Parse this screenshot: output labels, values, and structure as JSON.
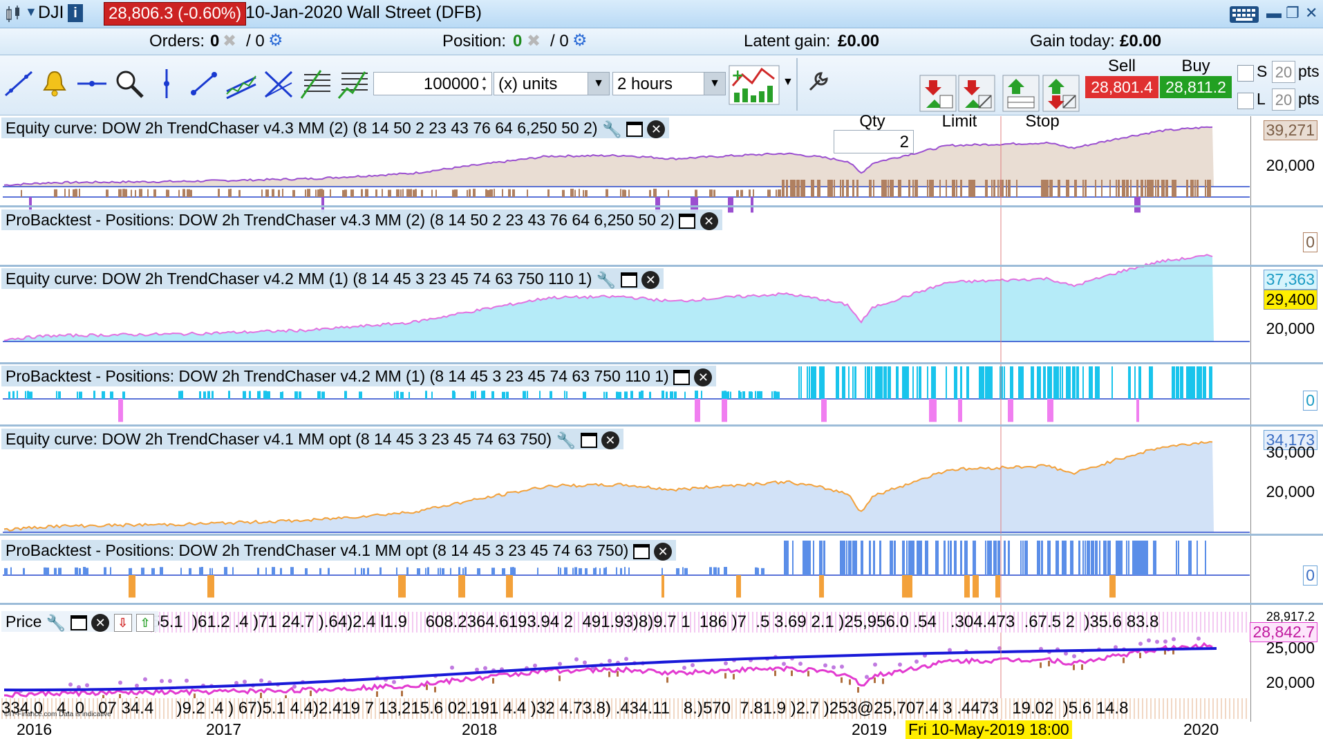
{
  "window": {
    "symbol": "DJI",
    "info_icon": "i",
    "price_change": "28,806.3 (-0.60%)",
    "date": "10-Jan-2020",
    "market": "Wall Street (DFB)"
  },
  "infobar": {
    "orders_label": "Orders:",
    "orders_value": "0",
    "orders_total": "/ 0",
    "position_label": "Position:",
    "position_value": "0",
    "position_total": "/ 0",
    "latent_label": "Latent gain:",
    "latent_value": "£0.00",
    "gain_today_label": "Gain today:",
    "gain_today_value": "£0.00"
  },
  "toolbar": {
    "units_value": "100000",
    "units_label": "(x) units",
    "timeframe": "2 hours",
    "qty_label": "Qty",
    "qty_value": "2",
    "limit_label": "Limit",
    "stop_label": "Stop",
    "sell_label": "Sell",
    "buy_label": "Buy",
    "sell_price": "28,801.4",
    "buy_price": "28,811.2",
    "s_label": "S",
    "l_label": "L",
    "s_pts_value": "20",
    "l_pts_value": "20",
    "pts_label": "pts"
  },
  "panels": {
    "eq3": {
      "title": "Equity curve: DOW 2h TrendChaser v4.3 MM (2) (8 14 50 2 23 43 76 64 6,250 50 2)",
      "last_value": "39,271",
      "axis_label": "20,000",
      "fill": "#e9ddd3",
      "line": "#9b4fd0"
    },
    "pos3": {
      "title": "ProBacktest - Positions: DOW 2h TrendChaser v4.3 MM (2) (8 14 50 2 23 43 76 64 6,250 50 2)",
      "axis_label": "0",
      "long_color": "#b08060",
      "short_color": "#9b4fd0"
    },
    "eq2": {
      "title": "Equity curve: DOW 2h TrendChaser v4.2 MM (1) (8 14 45 3 23 45 74 63 750 110 1)",
      "last_value": "37,363",
      "level_value": "29,400",
      "axis_label": "20,000",
      "fill": "#b5ebf8",
      "line": "#e271e0"
    },
    "pos2": {
      "title": "ProBacktest - Positions: DOW 2h TrendChaser v4.2 MM (1) (8 14 45 3 23 45 74 63 750 110 1)",
      "axis_label": "0",
      "long_color": "#19c4ec",
      "short_color": "#f07ef0"
    },
    "eq1": {
      "title": "Equity curve: DOW 2h TrendChaser v4.1 MM opt (8 14 45 3 23 45 74 63 750)",
      "last_value": "34,173",
      "axis_label_top": "30,000",
      "axis_label": "20,000",
      "fill": "#d2e2f7",
      "line": "#f3a13a"
    },
    "pos1": {
      "title": "ProBacktest - Positions: DOW 2h TrendChaser v4.1 MM opt (8 14 45 3 23 45 74 63 750)",
      "axis_label": "0",
      "long_color": "#5b8ee8",
      "short_color": "#f3a13a"
    },
    "price": {
      "title": "Price",
      "last_value": "28,842.7",
      "axis_top_label": "28,917.2",
      "axis_label_25k": "25,000",
      "axis_label_20k": "20,000",
      "top_labels": "55.1  )61.2 .4 )71 24.7 ).64)2.4 l1.9    608.2364.6193.94 2  491.93)8)9.7 1  186 )7  .5 3.69 2.1 )25,956.0 .54   .304.473  .67.5 2  )35.6 83.8",
      "bottom_labels": "334.0   4. 0   07 34.4     )9.2 .4 ) 67)5.1 4.4)2.419 7 13,215.6 02.191 4.4 )32 4.73.8) .434.11   8.)570  7.81.9 )2.7 )253@25,707.4 3 .4473   19.02  )5.6 14.8",
      "watermark": "©IT-Finance.com Data is indicative"
    }
  },
  "xaxis": {
    "labels": [
      "2016",
      "2017",
      "2018",
      "2019",
      "2020"
    ],
    "cursor": "Fri 10-May-2019 18:00"
  },
  "colors": {
    "accent": "#1d4f86",
    "sell": "#e03030",
    "buy": "#22a022",
    "price_line": "#e23ad0",
    "ma_line": "#1818d8",
    "cursor": "#e08080"
  }
}
